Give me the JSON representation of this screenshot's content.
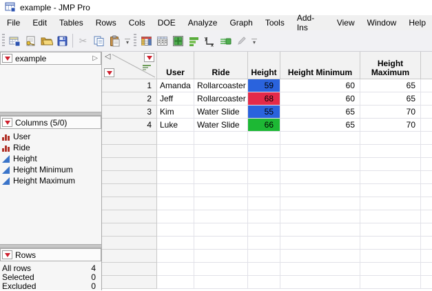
{
  "window": {
    "title": "example - JMP Pro"
  },
  "menu": {
    "items": [
      "File",
      "Edit",
      "Tables",
      "Rows",
      "Cols",
      "DOE",
      "Analyze",
      "Graph",
      "Tools",
      "Add-Ins",
      "View",
      "Window",
      "Help"
    ]
  },
  "toolbar": {
    "groups": [
      {
        "icons": [
          "new-data-table",
          "open-database",
          "open-folder",
          "save",
          "cut",
          "copy",
          "paste"
        ]
      },
      {
        "icons": [
          "data-table-colored",
          "summary-table",
          "tile-windows",
          "bar-chart",
          "fit-y-by-x",
          "formula",
          "edit"
        ]
      }
    ]
  },
  "sidebar": {
    "table_panel": {
      "title": "example"
    },
    "columns_panel": {
      "title": "Columns (5/0)",
      "items": [
        {
          "label": "User",
          "type": "nominal"
        },
        {
          "label": "Ride",
          "type": "nominal"
        },
        {
          "label": "Height",
          "type": "continuous"
        },
        {
          "label": "Height Minimum",
          "type": "continuous"
        },
        {
          "label": "Height Maximum",
          "type": "continuous"
        }
      ]
    },
    "rows_panel": {
      "title": "Rows",
      "stats": [
        {
          "label": "All rows",
          "value": "4"
        },
        {
          "label": "Selected",
          "value": "0"
        },
        {
          "label": "Excluded",
          "value": "0"
        }
      ]
    }
  },
  "table": {
    "columns": [
      "User",
      "Ride",
      "Height",
      "Height Minimum",
      "Height Maximum"
    ],
    "rows": [
      {
        "num": "1",
        "user": "Amanda",
        "ride": "Rollarcoaster",
        "height": "59",
        "height_color": "#2a63dd",
        "min": "60",
        "max": "65"
      },
      {
        "num": "2",
        "user": "Jeff",
        "ride": "Rollarcoaster",
        "height": "68",
        "height_color": "#e32a49",
        "min": "60",
        "max": "65"
      },
      {
        "num": "3",
        "user": "Kim",
        "ride": "Water Slide",
        "height": "55",
        "height_color": "#2a63dd",
        "min": "65",
        "max": "70"
      },
      {
        "num": "4",
        "user": "Luke",
        "ride": "Water Slide",
        "height": "66",
        "height_color": "#1db834",
        "min": "65",
        "max": "70"
      }
    ]
  },
  "colors": {
    "red_triangle": "#ce1f2d",
    "nominal_icon": "#b13228",
    "continuous_icon": "#3a74c9",
    "height_blue": "#2a63dd",
    "height_red": "#e32a49",
    "height_green": "#1db834"
  }
}
